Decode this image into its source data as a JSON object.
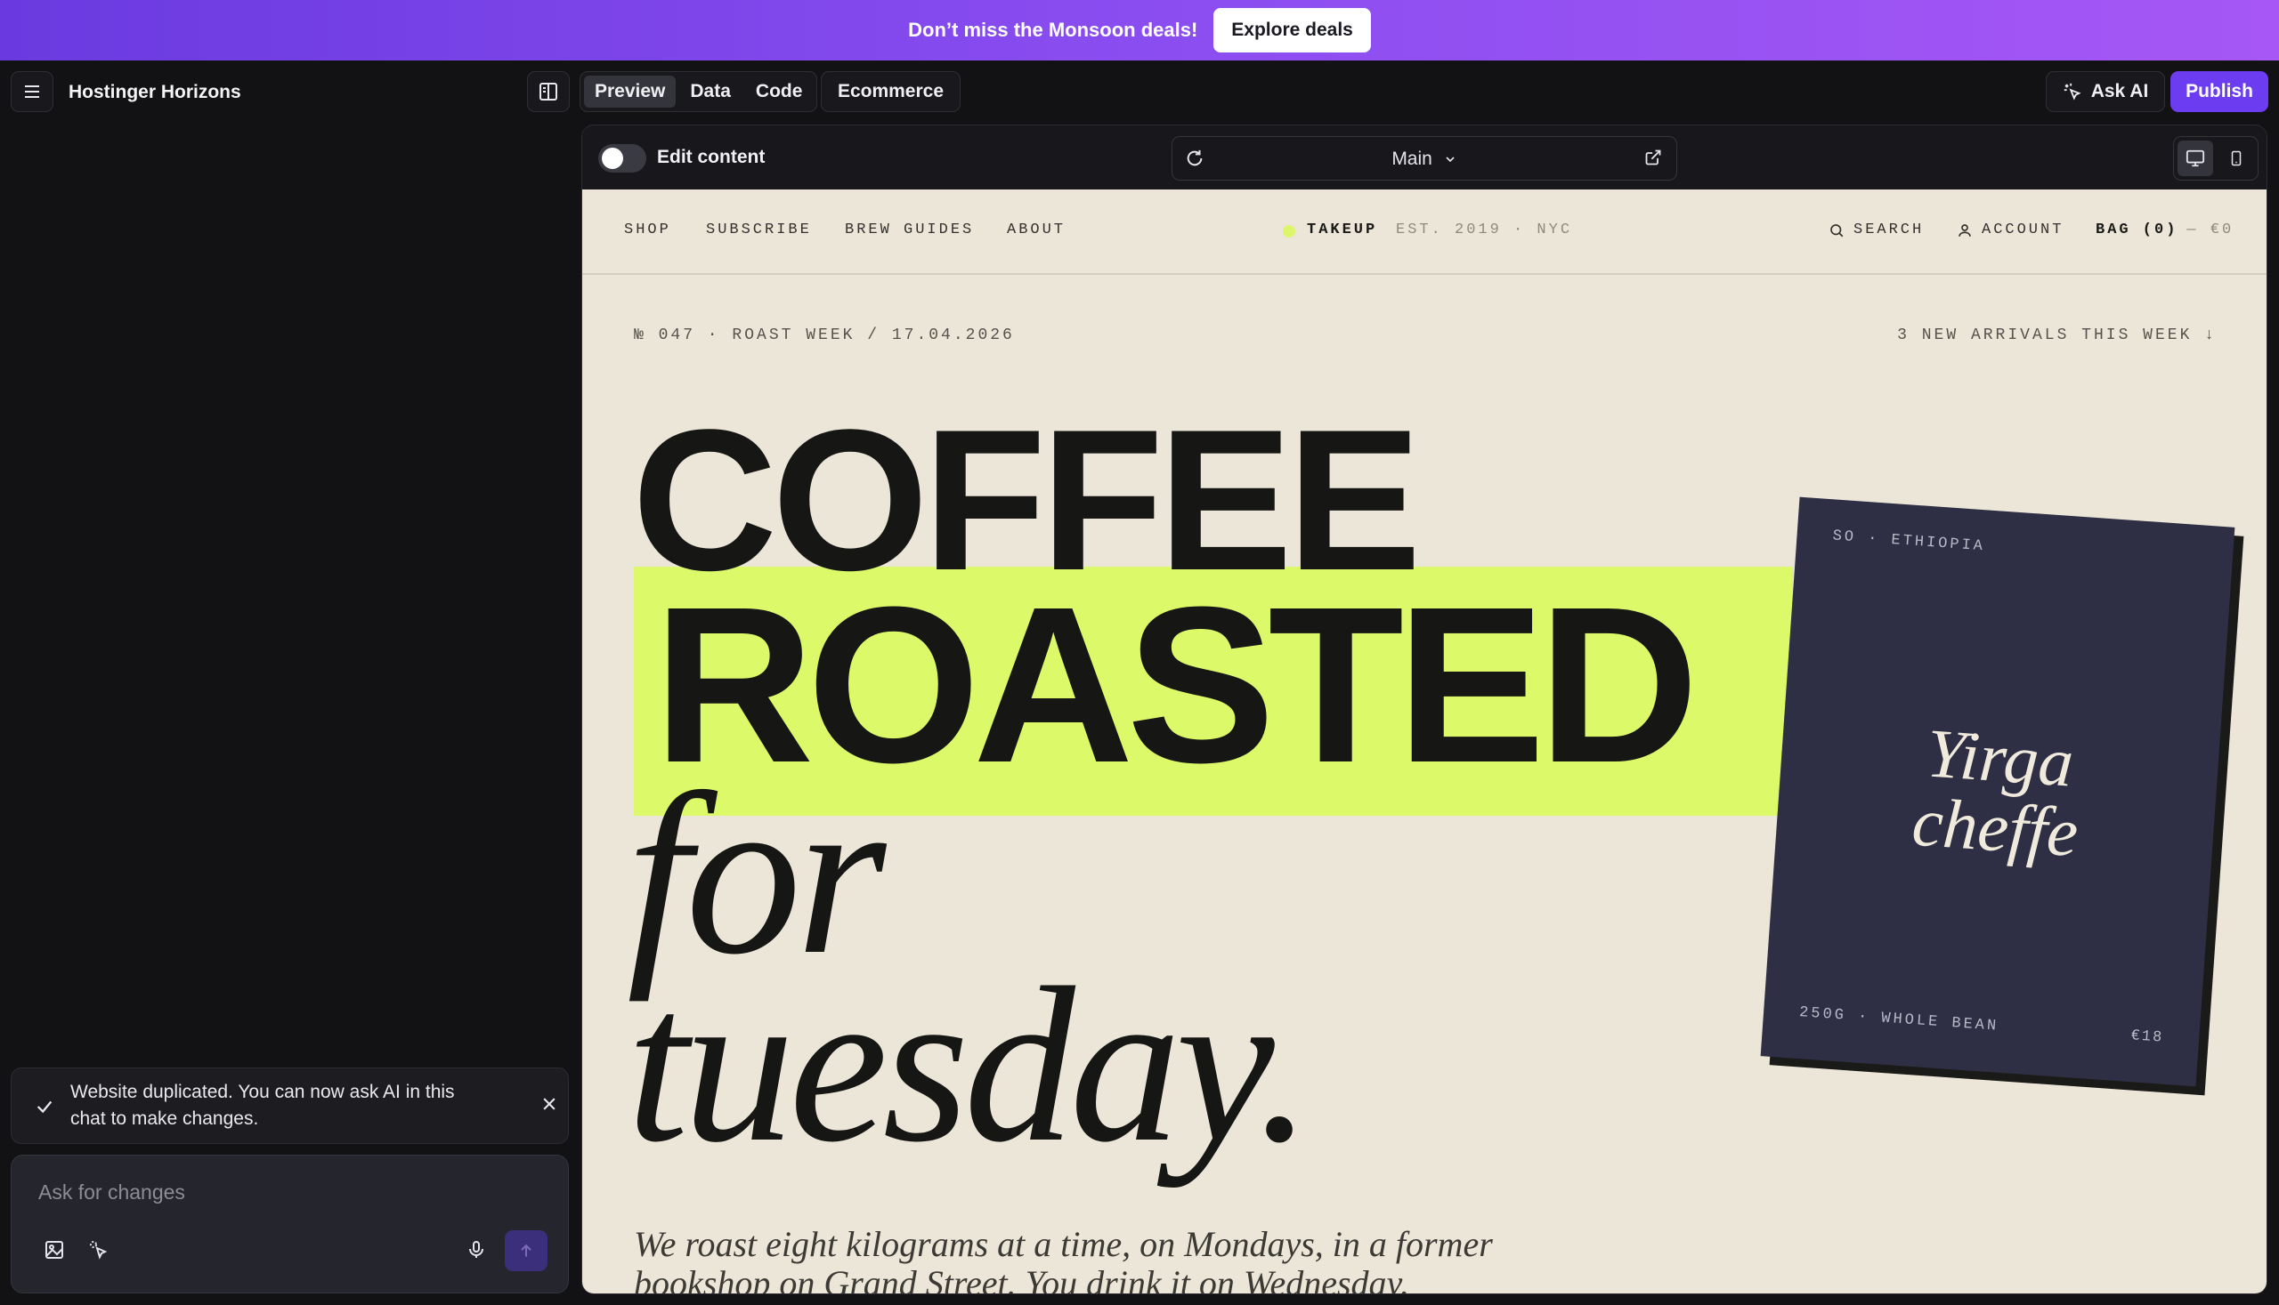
{
  "promo": {
    "text": "Don’t miss the Monsoon deals!",
    "button": "Explore deals"
  },
  "app": {
    "brand": "Hostinger Horizons",
    "tabs": [
      {
        "label": "Preview",
        "active": true
      },
      {
        "label": "Data",
        "active": false
      },
      {
        "label": "Code",
        "active": false
      }
    ],
    "ecommerce": "Ecommerce",
    "ask_ai": "Ask AI",
    "publish": "Publish",
    "accent": "#6c3df0"
  },
  "chat": {
    "toast": "Website duplicated. You can now ask AI in this chat to make changes.",
    "placeholder": "Ask for changes"
  },
  "preview_bar": {
    "edit_content": "Edit content",
    "page": "Main"
  },
  "site": {
    "nav_left": [
      "SHOP",
      "SUBSCRIBE",
      "BREW GUIDES",
      "ABOUT"
    ],
    "logo": "TAKEUP",
    "logo_meta": "EST. 2019 · NYC",
    "search": "SEARCH",
    "account": "ACCOUNT",
    "bag": "BAG (0)",
    "bag_total": "— €0",
    "issue": "№ 047 · ROAST WEEK / 17.04.2026",
    "arrivals": "3 NEW ARRIVALS THIS WEEK ↓",
    "headline": {
      "line1": "COFFEE",
      "line2": "ROASTED",
      "line3": "for",
      "line4": "tuesday."
    },
    "intro": "We roast eight kilograms at a time, on Mondays, in a former bookshop on Grand Street. You drink it on Wednesday.",
    "highlight_color": "#dcf96a",
    "product": {
      "origin": "SO · ETHIOPIA",
      "name_line1": "Yirga",
      "name_line2": "cheffe",
      "weight": "250G · WHOLE BEAN",
      "price": "€18",
      "color": "#2e2f44"
    }
  }
}
